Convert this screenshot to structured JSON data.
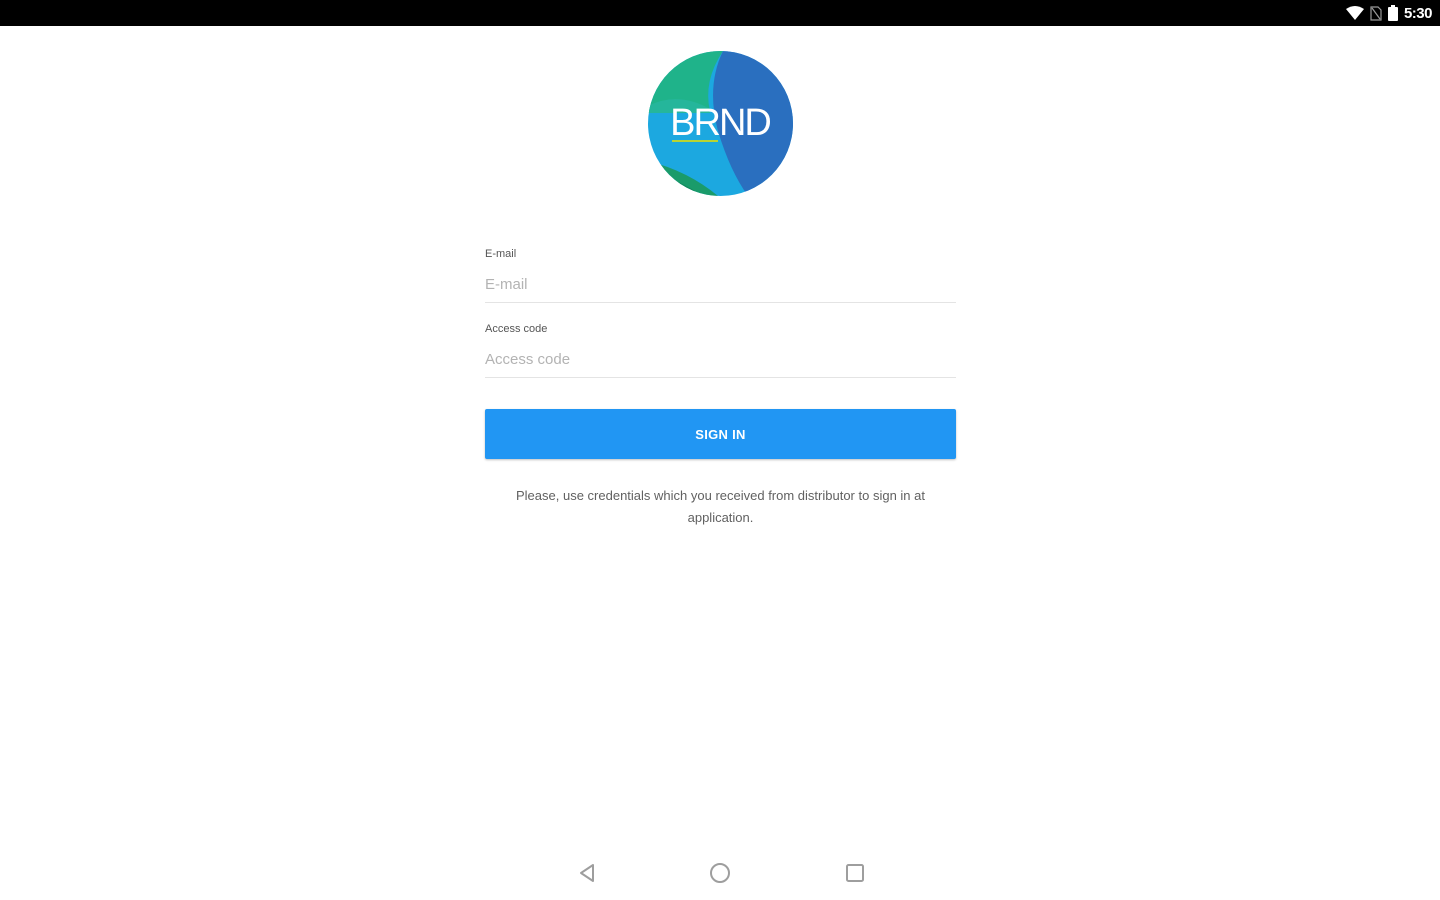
{
  "status_bar": {
    "time": "5:30",
    "icons": [
      "wifi-icon",
      "no-sim-icon",
      "battery-icon"
    ]
  },
  "logo": {
    "text": "BRND",
    "colors": [
      "#2bb673",
      "#1aa7d9",
      "#2f6fbf",
      "#0f9bd7"
    ]
  },
  "form": {
    "email": {
      "label": "E-mail",
      "placeholder": "E-mail",
      "value": ""
    },
    "access_code": {
      "label": "Access code",
      "placeholder": "Access code",
      "value": ""
    },
    "sign_in_label": "SIGN IN",
    "helper_text": "Please, use credentials which you received from distributor to sign in at application."
  },
  "nav_bar": {
    "icons": [
      "back-icon",
      "home-icon",
      "recents-icon"
    ]
  },
  "colors": {
    "primary": "#2196f3",
    "status_bar": "#000000"
  }
}
